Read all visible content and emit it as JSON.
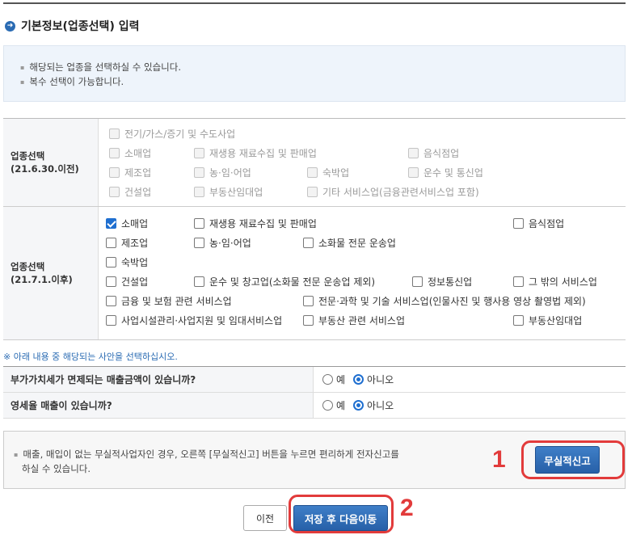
{
  "section_title": "기본정보(업종선택) 입력",
  "title_icon": "arrow-right-circle-icon",
  "info_lines": [
    "해당되는 업종을 선택하실 수 있습니다.",
    "복수 선택이 가능합니다."
  ],
  "industry_old": {
    "label_line1": "업종선택",
    "label_line2": "(21.6.30.이전)",
    "options": [
      "전기/가스/증기 및 수도사업",
      "소매업",
      "재생용 재료수집 및 판매업",
      "음식점업",
      "제조업",
      "농·임·어업",
      "숙박업",
      "운수 및 통신업",
      "건설업",
      "부동산임대업",
      "기타 서비스업(금융관련서비스업 포함)"
    ]
  },
  "industry_new": {
    "label_line1": "업종선택",
    "label_line2": "(21.7.1.이후)",
    "options": [
      {
        "label": "소매업",
        "checked": true
      },
      {
        "label": "재생용 재료수집 및 판매업",
        "checked": false
      },
      {
        "label": "음식점업",
        "checked": false
      },
      {
        "label": "제조업",
        "checked": false
      },
      {
        "label": "농·임·어업",
        "checked": false
      },
      {
        "label": "소화물 전문 운송업",
        "checked": false
      },
      {
        "label": "숙박업",
        "checked": false
      },
      {
        "label": "건설업",
        "checked": false
      },
      {
        "label": "운수 및 창고업(소화물 전문 운송업 제외)",
        "checked": false
      },
      {
        "label": "정보통신업",
        "checked": false
      },
      {
        "label": "그 밖의 서비스업",
        "checked": false
      },
      {
        "label": "금융 및 보험 관련 서비스업",
        "checked": false
      },
      {
        "label": "전문·과학 및 기술 서비스업(인물사진 및 행사용 영상 촬영법 제외)",
        "checked": false
      },
      {
        "label": "사업시설관리·사업지원 및 임대서비스업",
        "checked": false
      },
      {
        "label": "부동산 관련 서비스업",
        "checked": false
      },
      {
        "label": "부동산임대업",
        "checked": false
      }
    ]
  },
  "notice": "※ 아래 내용 중 해당되는 사안을 선택하십시오.",
  "questions": [
    {
      "question": "부가가치세가 면제되는 매출금액이 있습니까?",
      "yes": "예",
      "no": "아니오",
      "selected": "no"
    },
    {
      "question": "영세율 매출이 있습니까?",
      "yes": "예",
      "no": "아니오",
      "selected": "no"
    }
  ],
  "bottom_info": "매출, 매입이 없는 무실적사업자인 경우, 오른쪽 [무실적신고] 버튼을 누르면 편리하게 전자신고를 하실 수 있습니다.",
  "buttons": {
    "nil_report": "무실적신고",
    "prev": "이전",
    "save_next": "저장 후 다음이동"
  },
  "annotations": {
    "marker1": "1",
    "marker2": "2"
  },
  "colors": {
    "accent": "#2a6bb3",
    "button_blue": "#2760a8",
    "annotation_red": "#e23b3b",
    "checked_blue": "#1f6fd0"
  }
}
